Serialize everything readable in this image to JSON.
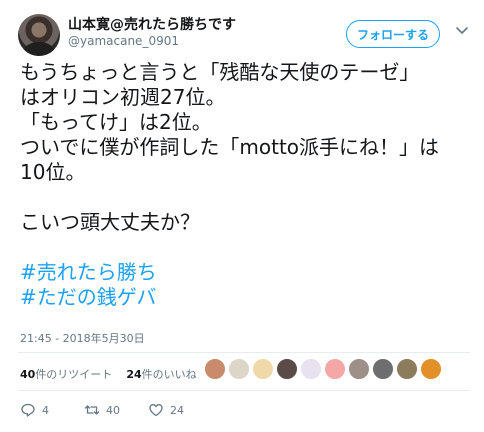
{
  "user": {
    "display_name": "山本寛@売れたら勝ちです",
    "handle": "@yamacane_0901"
  },
  "follow_button": {
    "label": "フォローする"
  },
  "tweet": {
    "lines": [
      "もうちょっと言うと「残酷な天使のテーゼ」",
      "はオリコン初週27位。",
      "「もってけ」は2位。",
      "ついでに僕が作詞した「motto派手にね！」は",
      "10位。",
      "",
      "こいつ頭大丈夫か？",
      ""
    ],
    "hashtags": [
      "#売れたら勝ち",
      "#ただの銭ゲバ"
    ],
    "timestamp": "21:45 - 2018年5月30日"
  },
  "stats": {
    "retweets_count": "40",
    "retweets_label": "件のリツイート",
    "likes_count": "24",
    "likes_label": "件のいいね"
  },
  "likers": {
    "colors": [
      "#c98b6b",
      "#dcd6c8",
      "#f0d9a8",
      "#5a4a48",
      "#e8e1f0",
      "#f3a7a7",
      "#9c9088",
      "#6e6e6e",
      "#8d7b5e",
      "#e2902a"
    ]
  },
  "actions": {
    "reply_count": "4",
    "retweet_count": "40",
    "like_count": "24"
  },
  "colors": {
    "accent": "#1da1f2",
    "text": "#14171a",
    "muted": "#657786"
  }
}
